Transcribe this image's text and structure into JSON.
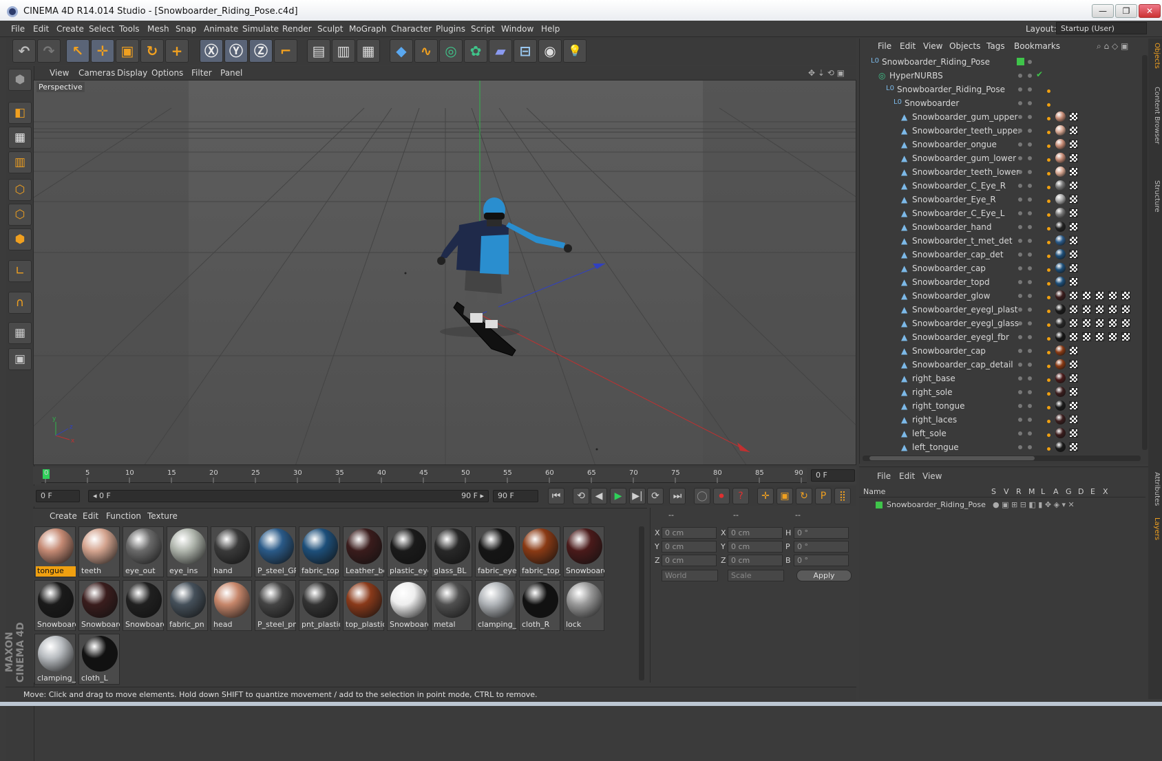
{
  "window": {
    "title": "CINEMA 4D R14.014 Studio - [Snowboarder_Riding_Pose.c4d]",
    "buttons": [
      "—",
      "❐",
      "✕"
    ]
  },
  "menu": {
    "items": [
      "File",
      "Edit",
      "Create",
      "Select",
      "Tools",
      "Mesh",
      "Snap",
      "Animate",
      "Simulate",
      "Render",
      "Sculpt",
      "MoGraph",
      "Character",
      "Plugins",
      "Script",
      "Window",
      "Help"
    ],
    "layout_label": "Layout:",
    "layout_value": "Startup (User)"
  },
  "toolbar": {
    "icons": [
      "undo-icon",
      "redo-icon",
      "select-icon",
      "move-icon",
      "scale-icon",
      "rotate-icon",
      "move-multi-icon",
      "x-axis-icon",
      "y-axis-icon",
      "z-axis-icon",
      "coordinate-system-icon",
      "render-view-icon",
      "render-picture-viewer-icon",
      "render-settings-icon",
      "cube-icon",
      "spline-icon",
      "nurbs-icon",
      "array-icon",
      "deformer-icon",
      "scene-floor-icon",
      "camera-icon",
      "light-icon"
    ],
    "glyphs": [
      "↶",
      "↷",
      "↖",
      "✛",
      "▣",
      "↻",
      "+",
      "Ⓧ",
      "Ⓨ",
      "Ⓩ",
      "⌐",
      "▤",
      "▥",
      "▦",
      "◆",
      "∿",
      "◎",
      "✿",
      "▰",
      "⊟",
      "◉",
      "💡"
    ]
  },
  "viewport": {
    "menu": [
      "View",
      "Cameras",
      "Display",
      "Options",
      "Filter",
      "Panel"
    ],
    "label": "Perspective",
    "axis_labels": [
      "y",
      "x",
      "z"
    ]
  },
  "timeline": {
    "ticks": [
      "0",
      "5",
      "10",
      "15",
      "20",
      "25",
      "30",
      "35",
      "40",
      "45",
      "50",
      "55",
      "60",
      "65",
      "70",
      "75",
      "80",
      "85",
      "90"
    ],
    "current_frame": "0 F"
  },
  "controls": {
    "start_field": "0 F",
    "range_start": "◂ 0 F",
    "range_end": "90 F ▸",
    "end_field": "90 F",
    "glyphs": [
      "⏮",
      "⟲",
      "◀",
      "▶",
      "▶|",
      "⟳",
      "⏭",
      "◯",
      "⏺",
      "?",
      "✛",
      "▣",
      "↻",
      "P",
      "⣿",
      "▦"
    ]
  },
  "materials": {
    "menu": [
      "Create",
      "Edit",
      "Function",
      "Texture"
    ],
    "items": [
      {
        "label": "tongue",
        "color": "#c58a74",
        "selected": true
      },
      {
        "label": "teeth",
        "color": "#d4a48f"
      },
      {
        "label": "eye_out",
        "color": "#6a6a6a"
      },
      {
        "label": "eye_ins",
        "color": "#b0b6ad"
      },
      {
        "label": "hand",
        "color": "#3a3a3a"
      },
      {
        "label": "P_steel_GP",
        "color": "#2a5a88"
      },
      {
        "label": "fabric_top",
        "color": "#1d4f7a"
      },
      {
        "label": "Leather_bo",
        "color": "#3a1c1c"
      },
      {
        "label": "plastic_eye",
        "color": "#1a1a1a"
      },
      {
        "label": "glass_BL",
        "color": "#282828"
      },
      {
        "label": "fabric_eye",
        "color": "#151515"
      },
      {
        "label": "fabric_top_",
        "color": "#8a3a14"
      },
      {
        "label": "Snowboarc",
        "color": "#4a1a1a"
      },
      {
        "label": "Snowboarc",
        "color": "#1a1a1a"
      },
      {
        "label": "Snowboarc",
        "color": "#3a1d1d"
      },
      {
        "label": "Snowboarc",
        "color": "#202020"
      },
      {
        "label": "fabric_pn",
        "color": "#45505a"
      },
      {
        "label": "head",
        "color": "#c6866a"
      },
      {
        "label": "P_steel_pnt",
        "color": "#444"
      },
      {
        "label": "pnt_plastic",
        "color": "#333"
      },
      {
        "label": "top_plastic",
        "color": "#8a3a1a"
      },
      {
        "label": "Snowboarc",
        "color": "#eee"
      },
      {
        "label": "metal",
        "color": "#505050"
      },
      {
        "label": "clamping_F",
        "color": "#b0b4b8"
      },
      {
        "label": "cloth_R",
        "color": "#111"
      },
      {
        "label": "lock",
        "color": "#999"
      },
      {
        "label": "clamping_L",
        "color": "#b8bcc0"
      },
      {
        "label": "cloth_L",
        "color": "#111"
      }
    ]
  },
  "coords": {
    "headers": [
      "--",
      "--",
      "--"
    ],
    "rows": [
      {
        "a": "X",
        "av": "0 cm",
        "b": "X",
        "bv": "0 cm",
        "c": "H",
        "cv": "0 °"
      },
      {
        "a": "Y",
        "av": "0 cm",
        "b": "Y",
        "bv": "0 cm",
        "c": "P",
        "cv": "0 °"
      },
      {
        "a": "Z",
        "av": "0 cm",
        "b": "Z",
        "bv": "0 cm",
        "c": "B",
        "cv": "0 °"
      }
    ],
    "world": "World",
    "scale": "Scale",
    "apply": "Apply"
  },
  "objects": {
    "menu": [
      "File",
      "Edit",
      "View",
      "Objects",
      "Tags",
      "Bookmarks"
    ],
    "items": [
      {
        "name": "Snowboarder_Riding_Pose",
        "indent": 0,
        "type": "null"
      },
      {
        "name": "HyperNURBS",
        "indent": 1,
        "type": "nurbs"
      },
      {
        "name": "Snowboarder_Riding_Pose",
        "indent": 2,
        "type": "null"
      },
      {
        "name": "Snowboarder",
        "indent": 3,
        "type": "null"
      },
      {
        "name": "Snowboarder_gum_upper",
        "indent": 4,
        "type": "mesh",
        "mat": "#c58a74",
        "tags": 1
      },
      {
        "name": "Snowboarder_teeth_upper",
        "indent": 4,
        "type": "mesh",
        "mat": "#d4a48f",
        "tags": 1
      },
      {
        "name": "Snowboarder_ongue",
        "indent": 4,
        "type": "mesh",
        "mat": "#c58a74",
        "tags": 1
      },
      {
        "name": "Snowboarder_gum_lower",
        "indent": 4,
        "type": "mesh",
        "mat": "#c58a74",
        "tags": 1
      },
      {
        "name": "Snowboarder_teeth_lower",
        "indent": 4,
        "type": "mesh",
        "mat": "#d4a48f",
        "tags": 1
      },
      {
        "name": "Snowboarder_C_Eye_R",
        "indent": 4,
        "type": "mesh",
        "mat": "#777",
        "tags": 1
      },
      {
        "name": "Snowboarder_Eye_R",
        "indent": 4,
        "type": "mesh",
        "mat": "#aaa",
        "tags": 1
      },
      {
        "name": "Snowboarder_C_Eye_L",
        "indent": 4,
        "type": "mesh",
        "mat": "#777",
        "tags": 1
      },
      {
        "name": "Snowboarder_hand",
        "indent": 4,
        "type": "mesh",
        "mat": "#222",
        "tags": 1
      },
      {
        "name": "Snowboarder_t_met_det",
        "indent": 4,
        "type": "mesh",
        "mat": "#2a5a88",
        "tags": 1
      },
      {
        "name": "Snowboarder_cap_det",
        "indent": 4,
        "type": "mesh",
        "mat": "#1d4f7a",
        "tags": 1
      },
      {
        "name": "Snowboarder_cap",
        "indent": 4,
        "type": "mesh",
        "mat": "#1d4f7a",
        "tags": 1
      },
      {
        "name": "Snowboarder_topd",
        "indent": 4,
        "type": "mesh",
        "mat": "#1d4f7a",
        "tags": 1
      },
      {
        "name": "Snowboarder_glow",
        "indent": 4,
        "type": "mesh",
        "mat": "#3a1c1c",
        "tags": 5
      },
      {
        "name": "Snowboarder_eyegl_plast",
        "indent": 4,
        "type": "mesh",
        "mat": "#1a1a1a",
        "tags": 5
      },
      {
        "name": "Snowboarder_eyegl_glass",
        "indent": 4,
        "type": "mesh",
        "mat": "#282828",
        "tags": 5
      },
      {
        "name": "Snowboarder_eyegl_fbr",
        "indent": 4,
        "type": "mesh",
        "mat": "#151515",
        "tags": 5
      },
      {
        "name": "Snowboarder_cap",
        "indent": 4,
        "type": "mesh",
        "mat": "#8a3a14",
        "tags": 1
      },
      {
        "name": "Snowboarder_cap_detail",
        "indent": 4,
        "type": "mesh",
        "mat": "#8a3a14",
        "tags": 1
      },
      {
        "name": "right_base",
        "indent": 4,
        "type": "mesh",
        "mat": "#4a1a1a",
        "tags": 1
      },
      {
        "name": "right_sole",
        "indent": 4,
        "type": "mesh",
        "mat": "#3a1d1d",
        "tags": 1
      },
      {
        "name": "right_tongue",
        "indent": 4,
        "type": "mesh",
        "mat": "#1a1a1a",
        "tags": 1
      },
      {
        "name": "right_laces",
        "indent": 4,
        "type": "mesh",
        "mat": "#3a1d1d",
        "tags": 1
      },
      {
        "name": "left_sole",
        "indent": 4,
        "type": "mesh",
        "mat": "#3a1d1d",
        "tags": 1
      },
      {
        "name": "left_tongue",
        "indent": 4,
        "type": "mesh",
        "mat": "#1a1a1a",
        "tags": 1
      }
    ]
  },
  "layers": {
    "menu": [
      "File",
      "Edit",
      "View"
    ],
    "columns": [
      "Name",
      "S",
      "V",
      "R",
      "M",
      "L",
      "A",
      "G",
      "D",
      "E",
      "X"
    ],
    "row": "Snowboarder_Riding_Pose"
  },
  "side_tabs": [
    "Objects",
    "Content Browser",
    "Structure",
    "Attributes",
    "Layers"
  ],
  "status": "Move: Click and drag to move elements. Hold down SHIFT to quantize movement / add to the selection in point mode, CTRL to remove.",
  "logo": "MAXON CINEMA 4D"
}
